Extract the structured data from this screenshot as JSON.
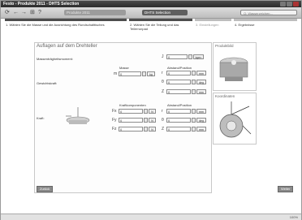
{
  "window": {
    "title": "Festo - Produkte 2011 - DHTS Selection"
  },
  "toolbar": {
    "icons": [
      "refresh-icon",
      "back-icon",
      "forward-icon",
      "bookmark-icon",
      "help-icon"
    ],
    "tabs": [
      {
        "label": "Produkte 2011"
      },
      {
        "label": "DHTS Selection"
      }
    ],
    "search_placeholder": "Q: Wasserzeichen..."
  },
  "steps": [
    {
      "label": "1. Wählen Sie die Masse und die Ausrichtung des Rundschalttisches"
    },
    {
      "label": "2. Wählen Sie die Teilung und das Teilerrunpad"
    },
    {
      "label": "3. Einstellungen"
    },
    {
      "label": "4. Ergebnisse"
    }
  ],
  "panel": {
    "title": "Auflagen auf dem Drehteller",
    "rows": [
      {
        "label": "Massenträgheitsmoment:"
      },
      {
        "label": "Gewichtskraft:"
      },
      {
        "label": "Kraft:"
      }
    ],
    "inertia": {
      "symbol": "J",
      "value": "0",
      "unit": "kgm²"
    },
    "mass_header": "Masse",
    "distance_header": "Abstand/Position",
    "mass": {
      "symbol": "m",
      "value": "0",
      "unit": "kg"
    },
    "weight_offsets": [
      {
        "symbol": "r",
        "value": "0",
        "unit": "mm"
      },
      {
        "symbol": "θ",
        "value": "0",
        "unit": "deg"
      },
      {
        "symbol": "Z",
        "value": "0",
        "unit": "mm"
      }
    ],
    "force_header": "Kraftkomponenten",
    "force_distance_header": "Abstand/Position",
    "forces": [
      {
        "symbol": "Fx",
        "value": "0",
        "unit": "N"
      },
      {
        "symbol": "Fy",
        "value": "0",
        "unit": "N"
      },
      {
        "symbol": "Fz",
        "value": "0",
        "unit": "N"
      }
    ],
    "force_offsets": [
      {
        "symbol": "r",
        "value": "0",
        "unit": "mm"
      },
      {
        "symbol": "θ",
        "value": "0",
        "unit": "deg"
      },
      {
        "symbol": "Z",
        "value": "0",
        "unit": "mm"
      }
    ]
  },
  "sidebar": {
    "product_image_title": "Produktbild",
    "coordinate_title": "Koordinaten"
  },
  "nav": {
    "back_label": "Zurück",
    "next_label": "Weiter"
  },
  "status": {
    "zoom": "100%"
  },
  "colors": {
    "accent": "#5f5f5f",
    "step_active": "#4d4d4d",
    "step_inactive": "#bdbdbd"
  }
}
